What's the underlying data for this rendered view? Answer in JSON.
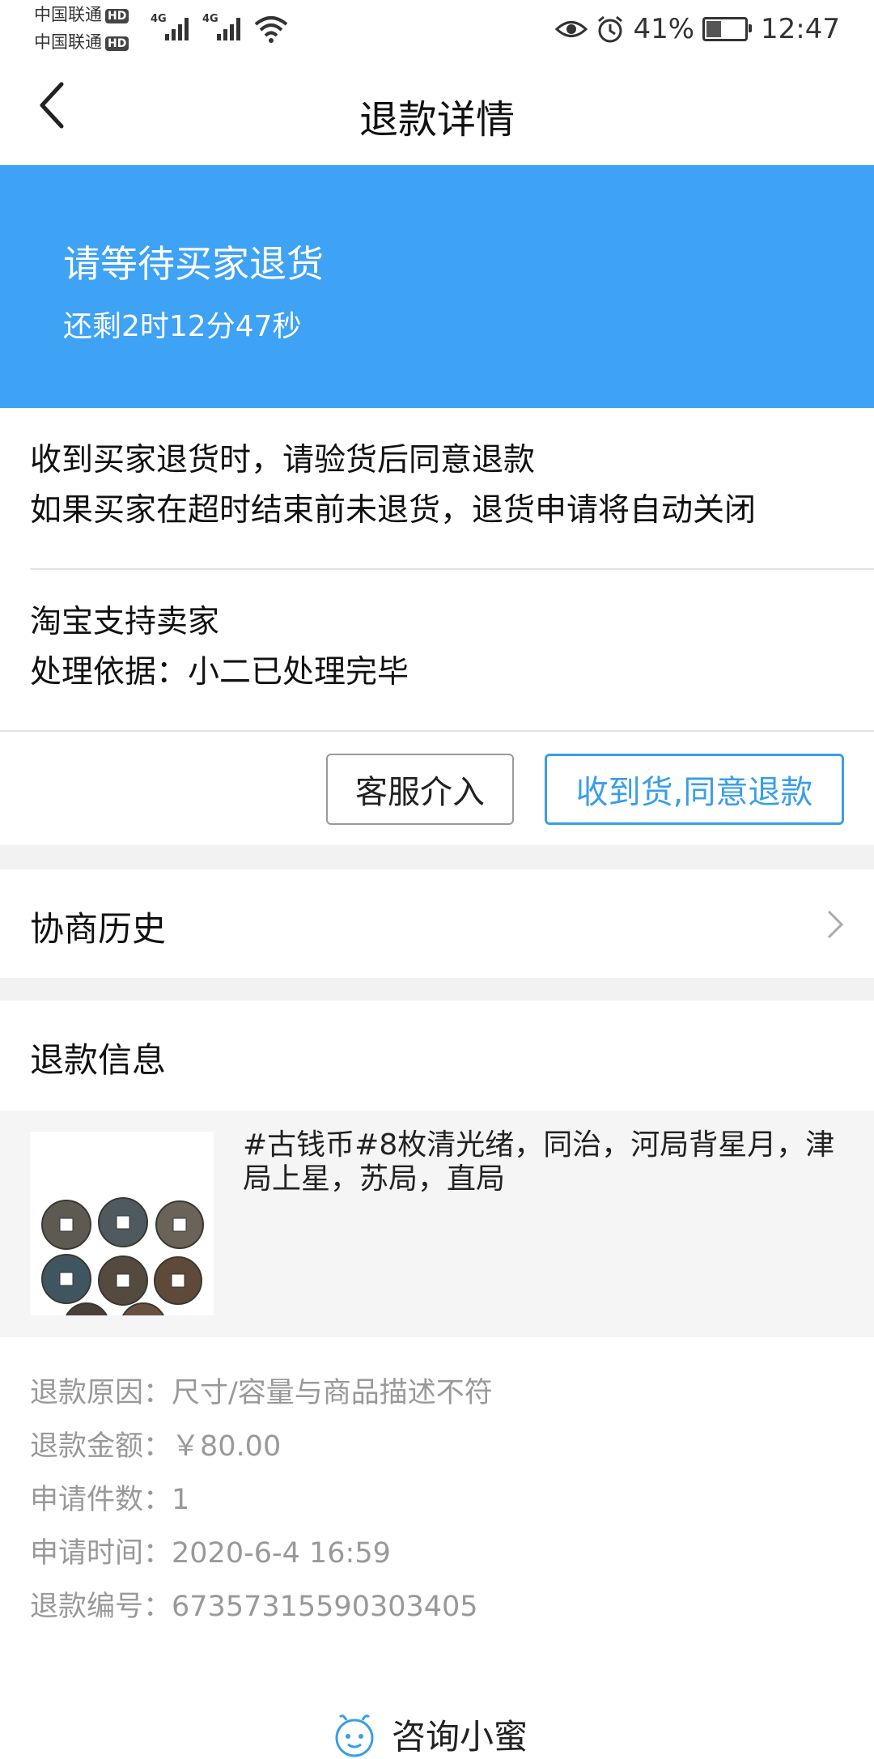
{
  "status_bar": {
    "carrier1": "中国联通",
    "carrier2": "中国联通",
    "hd": "HD",
    "network1": "4G",
    "network2": "4G",
    "battery_text": "41%",
    "battery_level": 0.41,
    "time": "12:47"
  },
  "nav": {
    "title": "退款详情"
  },
  "banner": {
    "title": "请等待买家退货",
    "countdown": "还剩2时12分47秒",
    "color": "#3ea2f5"
  },
  "notice": {
    "line1": "收到买家退货时，请验货后同意退款",
    "line2": "如果买家在超时结束前未退货，退货申请将自动关闭"
  },
  "decision": {
    "line1": "淘宝支持卖家",
    "line2": "处理依据：小二已处理完毕"
  },
  "actions": {
    "customer_service": "客服介入",
    "agree_refund": "收到货,同意退款",
    "accent_color": "#3a9ee8"
  },
  "history": {
    "label": "协商历史"
  },
  "refund_info": {
    "title": "退款信息",
    "product": {
      "title": "#古钱币#8枚清光绪，同治，河局背星月，津局上星，苏局，直局"
    },
    "details": [
      {
        "label": "退款原因：",
        "value": "尺寸/容量与商品描述不符"
      },
      {
        "label": "退款金额：",
        "value": "￥80.00"
      },
      {
        "label": "申请件数：",
        "value": "1"
      },
      {
        "label": "申请时间：",
        "value": "2020-6-4 16:59"
      },
      {
        "label": "退款编号：",
        "value": "67357315590303405"
      }
    ]
  },
  "footer": {
    "consult_label": "咨询小蜜"
  }
}
